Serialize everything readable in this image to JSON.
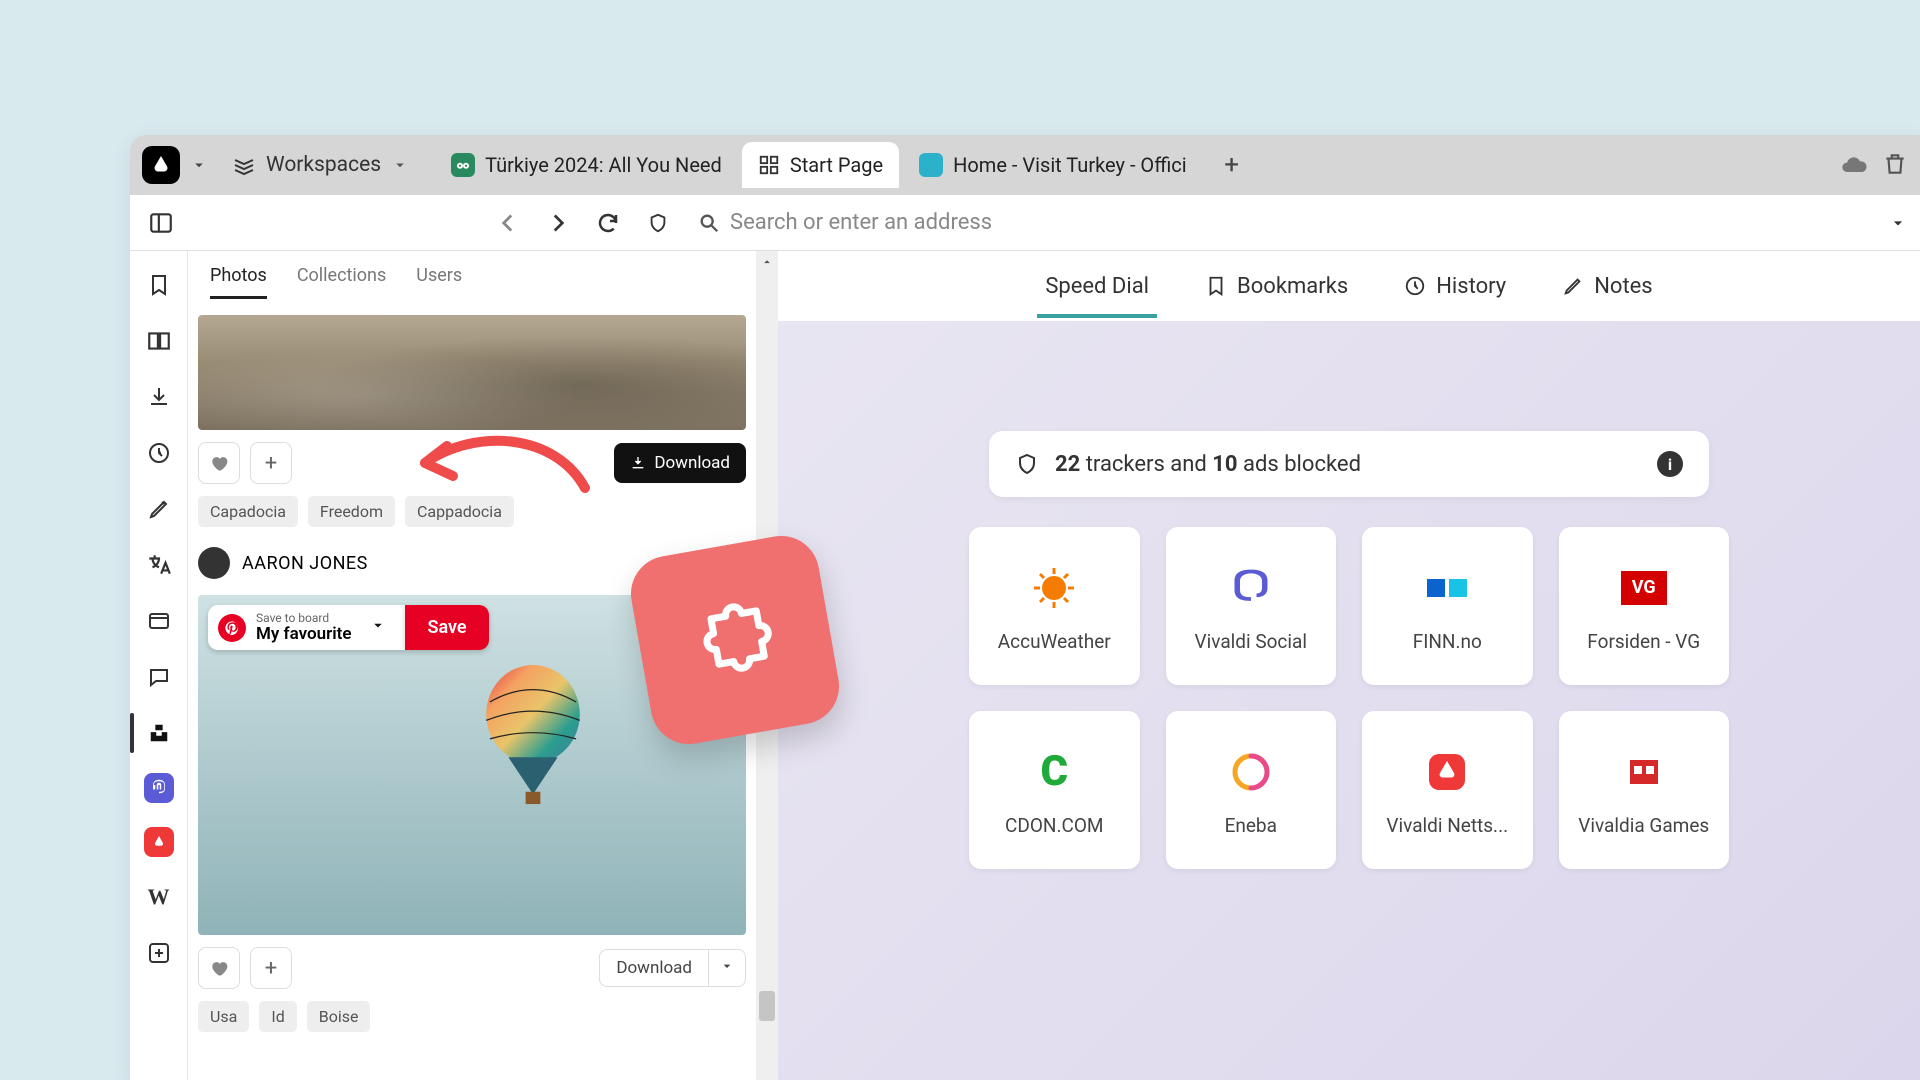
{
  "titlebar": {
    "workspaces_label": "Workspaces",
    "tabs": [
      {
        "label": "Türkiye 2024: All You Need"
      },
      {
        "label": "Start Page"
      },
      {
        "label": "Home - Visit Turkey - Offici"
      }
    ]
  },
  "addressbar": {
    "placeholder": "Search or enter an address"
  },
  "panel": {
    "tabs": [
      "Photos",
      "Collections",
      "Users"
    ],
    "card1": {
      "download_label": "Download",
      "tags": [
        "Capadocia",
        "Freedom",
        "Cappadocia"
      ]
    },
    "author": "AARON JONES",
    "pin": {
      "save_to_label": "Save to board",
      "board_name": "My favourite",
      "save_label": "Save"
    },
    "card2": {
      "download_label": "Download",
      "tags": [
        "Usa",
        "Id",
        "Boise"
      ]
    }
  },
  "start": {
    "tabs": {
      "speed_dial": "Speed Dial",
      "bookmarks": "Bookmarks",
      "history": "History",
      "notes": "Notes"
    },
    "tracker": {
      "n_trackers": "22",
      "trackers_word": "trackers and",
      "n_ads": "10",
      "ads_word": "ads blocked"
    },
    "tiles": [
      "AccuWeather",
      "Vivaldi Social",
      "FINN.no",
      "Forsiden - VG",
      "CDON.COM",
      "Eneba",
      "Vivaldi Netts...",
      "Vivaldia Games"
    ]
  }
}
